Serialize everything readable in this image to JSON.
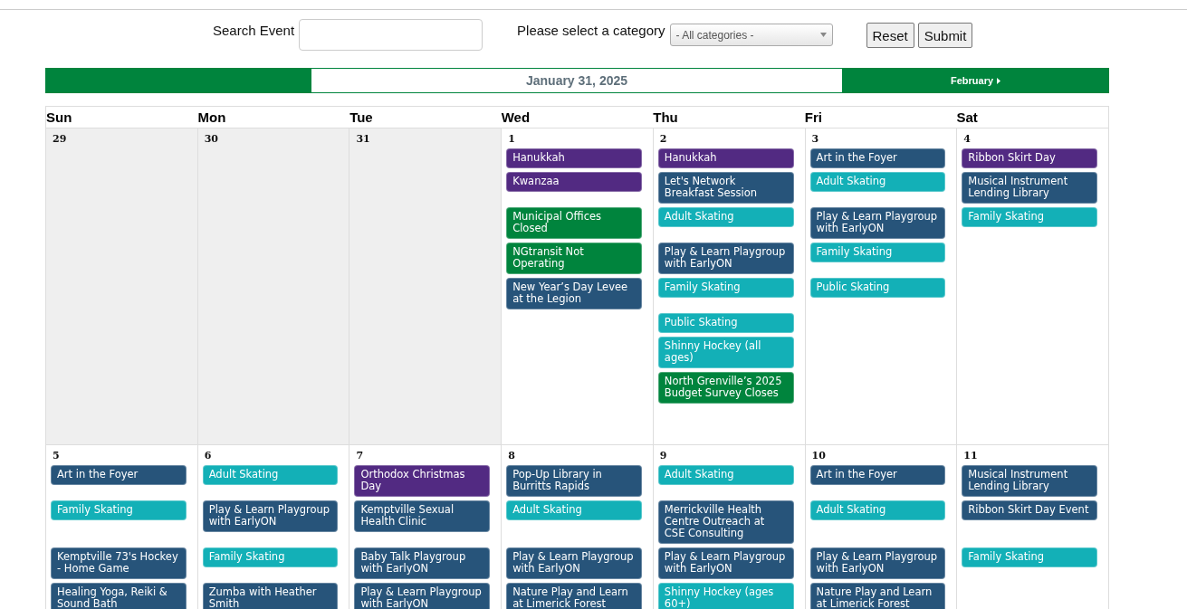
{
  "search": {
    "label": "Search Event"
  },
  "category": {
    "label": "Please select a category",
    "value": "- All categories -"
  },
  "buttons": [
    "Reset",
    "Submit"
  ],
  "nav": {
    "current": "January 31, 2025",
    "next": "February"
  },
  "weekdays": [
    "Sun",
    "Mon",
    "Tue",
    "Wed",
    "Thu",
    "Fri",
    "Sat"
  ],
  "weeks": [
    {
      "days": [
        {
          "date": "29",
          "other_month": true
        },
        {
          "date": "30",
          "other_month": true
        },
        {
          "date": "31",
          "other_month": true
        },
        {
          "date": "1",
          "other_month": false,
          "events": [
            {
              "title": "Hanukkah",
              "color": "#522a82"
            },
            {
              "title": "Kwanzaa",
              "color": "#522a82"
            },
            {
              "title": "Municipal Offices Closed",
              "color": "#00843d"
            },
            {
              "title": "NGtransit Not Operating",
              "color": "#00843d"
            },
            {
              "title": "New Year’s Day Levee at the Legion",
              "color": "#27547a"
            }
          ]
        },
        {
          "date": "2",
          "other_month": false,
          "events": [
            {
              "title": "Hanukkah",
              "color": "#522a82"
            },
            {
              "title": "Let's Network Breakfast Session",
              "color": "#27547a"
            },
            {
              "title": "Adult Skating",
              "color": "#13b0b7"
            },
            {
              "title": "Play & Learn Playgroup with EarlyON",
              "color": "#27547a"
            },
            {
              "title": "Family Skating",
              "color": "#13b0b7"
            },
            {
              "title": "Public Skating",
              "color": "#13b0b7"
            },
            {
              "title": "Shinny Hockey (all ages)",
              "color": "#13b0b7"
            },
            {
              "title": "North Grenville’s 2025 Budget Survey Closes",
              "color": "#00843d"
            }
          ]
        },
        {
          "date": "3",
          "other_month": false,
          "events": [
            {
              "title": "Art in the Foyer",
              "color": "#27547a"
            },
            {
              "title": "Adult Skating",
              "color": "#13b0b7"
            },
            {
              "title": "Play & Learn Playgroup with EarlyON",
              "color": "#27547a"
            },
            {
              "title": "Family Skating",
              "color": "#13b0b7"
            },
            {
              "title": "Public Skating",
              "color": "#13b0b7"
            }
          ]
        },
        {
          "date": "4",
          "other_month": false,
          "events": [
            {
              "title": "Ribbon Skirt Day",
              "color": "#522a82"
            },
            {
              "title": "Musical Instrument Lending Library",
              "color": "#27547a"
            },
            {
              "title": "Family Skating",
              "color": "#13b0b7"
            }
          ]
        }
      ]
    },
    {
      "days": [
        {
          "date": "5",
          "other_month": false,
          "events": [
            {
              "title": "Art in the Foyer",
              "color": "#27547a"
            },
            {
              "title": "Family Skating",
              "color": "#13b0b7"
            },
            {
              "title": "Kemptville 73's Hockey - Home Game",
              "color": "#27547a"
            },
            {
              "title": "Healing Yoga, Reiki & Sound Bath",
              "color": "#27547a"
            }
          ]
        },
        {
          "date": "6",
          "other_month": false,
          "events": [
            {
              "title": "Adult Skating",
              "color": "#13b0b7"
            },
            {
              "title": "Play & Learn Playgroup with EarlyON",
              "color": "#27547a"
            },
            {
              "title": "Family Skating",
              "color": "#13b0b7"
            },
            {
              "title": "Zumba with Heather Smith",
              "color": "#27547a"
            }
          ]
        },
        {
          "date": "7",
          "other_month": false,
          "events": [
            {
              "title": "Orthodox Christmas Day",
              "color": "#522a82"
            },
            {
              "title": "Kemptville Sexual Health Clinic",
              "color": "#27547a"
            },
            {
              "title": "Baby Talk Playgroup with EarlyON",
              "color": "#27547a"
            },
            {
              "title": "Play & Learn Playgroup with EarlyON",
              "color": "#27547a"
            }
          ]
        },
        {
          "date": "8",
          "other_month": false,
          "events": [
            {
              "title": "Pop-Up Library in Burritts Rapids",
              "color": "#27547a"
            },
            {
              "title": "Adult Skating",
              "color": "#13b0b7"
            },
            {
              "title": "Play & Learn Playgroup with EarlyON",
              "color": "#27547a"
            },
            {
              "title": "Nature Play and Learn at Limerick Forest",
              "color": "#27547a"
            }
          ]
        },
        {
          "date": "9",
          "other_month": false,
          "events": [
            {
              "title": "Adult Skating",
              "color": "#13b0b7"
            },
            {
              "title": "Merrickville Health Centre Outreach at CSE Consulting",
              "color": "#27547a"
            },
            {
              "title": "Play & Learn Playgroup with EarlyON",
              "color": "#27547a"
            },
            {
              "title": "Shinny Hockey (ages 60+)",
              "color": "#13b0b7"
            }
          ]
        },
        {
          "date": "10",
          "other_month": false,
          "events": [
            {
              "title": "Art in the Foyer",
              "color": "#27547a"
            },
            {
              "title": "Adult Skating",
              "color": "#13b0b7"
            },
            {
              "title": "Play & Learn Playgroup with EarlyON",
              "color": "#27547a"
            },
            {
              "title": "Nature Play and Learn at Limerick Forest",
              "color": "#27547a"
            }
          ]
        },
        {
          "date": "11",
          "other_month": false,
          "events": [
            {
              "title": "Musical Instrument Lending Library",
              "color": "#27547a"
            },
            {
              "title": "Ribbon Skirt Day Event",
              "color": "#27547a"
            },
            {
              "title": "Family Skating",
              "color": "#13b0b7"
            }
          ]
        }
      ]
    }
  ]
}
